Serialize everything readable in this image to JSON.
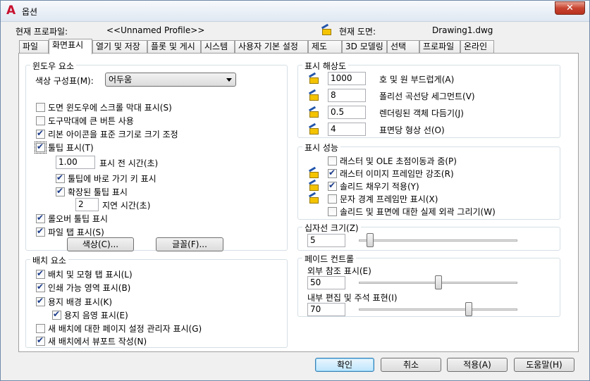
{
  "window": {
    "title": "옵션",
    "close": "✕"
  },
  "profile": {
    "current_profile_label": "현재 프로파일:",
    "current_profile_value": "<<Unnamed Profile>>",
    "current_drawing_label": "현재 도면:",
    "current_drawing_value": "Drawing1.dwg"
  },
  "tabs": [
    "파일",
    "화면표시",
    "열기 및 저장",
    "플롯 및 게시",
    "시스템",
    "사용자 기본 설정",
    "제도",
    "3D 모델링",
    "선택",
    "프로파일",
    "온라인"
  ],
  "window_elements": {
    "title": "윈도우 요소",
    "color_scheme_label": "색상 구성표(M):",
    "color_scheme_value": "어두움",
    "checkboxes": [
      {
        "label": "도면 윈도우에 스크롤 막대 표시(S)",
        "checked": false
      },
      {
        "label": "도구막대에 큰 버튼 사용",
        "checked": false
      },
      {
        "label": "리본 아이콘을 표준 크기로 크기 조정",
        "checked": true
      },
      {
        "label": "툴팁 표시(T)",
        "checked": true
      }
    ],
    "tooltip_delay_value": "1.00",
    "tooltip_delay_label": "표시 전 시간(초)",
    "shortcut_tooltip": {
      "label": "툴팁에 바로 가기 키 표시",
      "checked": true
    },
    "extended_tooltip": {
      "label": "확장된 툴팁 표시",
      "checked": true
    },
    "extended_delay_value": "2",
    "extended_delay_label": "지연 시간(초)",
    "rollover_tooltip": {
      "label": "롤오버 툴팁 표시",
      "checked": true
    },
    "file_tabs": {
      "label": "파일 탭 표시(S)",
      "checked": true
    },
    "colors_button": "색상(C)...",
    "fonts_button": "글꼴(F)..."
  },
  "layout_elements": {
    "title": "배치 요소",
    "items": [
      {
        "label": "배치 및 모형 탭 표시(L)",
        "checked": true
      },
      {
        "label": "인쇄 가능 영역 표시(B)",
        "checked": true
      },
      {
        "label": "용지 배경 표시(K)",
        "checked": true
      },
      {
        "label": "용지 음영 표시(E)",
        "checked": true
      },
      {
        "label": "새 배치에 대한 페이지 설정 관리자 표시(G)",
        "checked": false
      },
      {
        "label": "새 배치에서 뷰포트 작성(N)",
        "checked": true
      }
    ]
  },
  "resolution": {
    "title": "표시 해상도",
    "rows": [
      {
        "value": "1000",
        "label": "호 및 원 부드럽게(A)"
      },
      {
        "value": "8",
        "label": "폴리선 곡선당 세그먼트(V)"
      },
      {
        "value": "0.5",
        "label": "렌더링된 객체 다듬기(J)"
      },
      {
        "value": "4",
        "label": "표면당 형상 선(O)"
      }
    ]
  },
  "performance": {
    "title": "표시 성능",
    "items": [
      {
        "label": "래스터 및 OLE 초점이동과 줌(P)",
        "checked": false,
        "icon": false
      },
      {
        "label": "래스터 이미지 프레임만 강조(R)",
        "checked": true,
        "icon": true
      },
      {
        "label": "솔리드 채우기 적용(Y)",
        "checked": true,
        "icon": true
      },
      {
        "label": "문자 경계 프레임만 표시(X)",
        "checked": false,
        "icon": true
      },
      {
        "label": "솔리드 및 표면에 대한 실제 외곽 그리기(W)",
        "checked": false,
        "icon": false
      }
    ]
  },
  "crosshair": {
    "title": "십자선 크기(Z)",
    "value": "5",
    "fraction": 0.05
  },
  "fade": {
    "title": "페이드 컨트롤",
    "xref_label": "외부 참조 표시(E)",
    "xref_value": "50",
    "xref_fraction": 0.5,
    "inplace_label": "내부 편집 및 주석 표현(I)",
    "inplace_value": "70",
    "inplace_fraction": 0.7
  },
  "buttons": {
    "ok": "확인",
    "cancel": "취소",
    "apply": "적용(A)",
    "help": "도움말(H)"
  }
}
